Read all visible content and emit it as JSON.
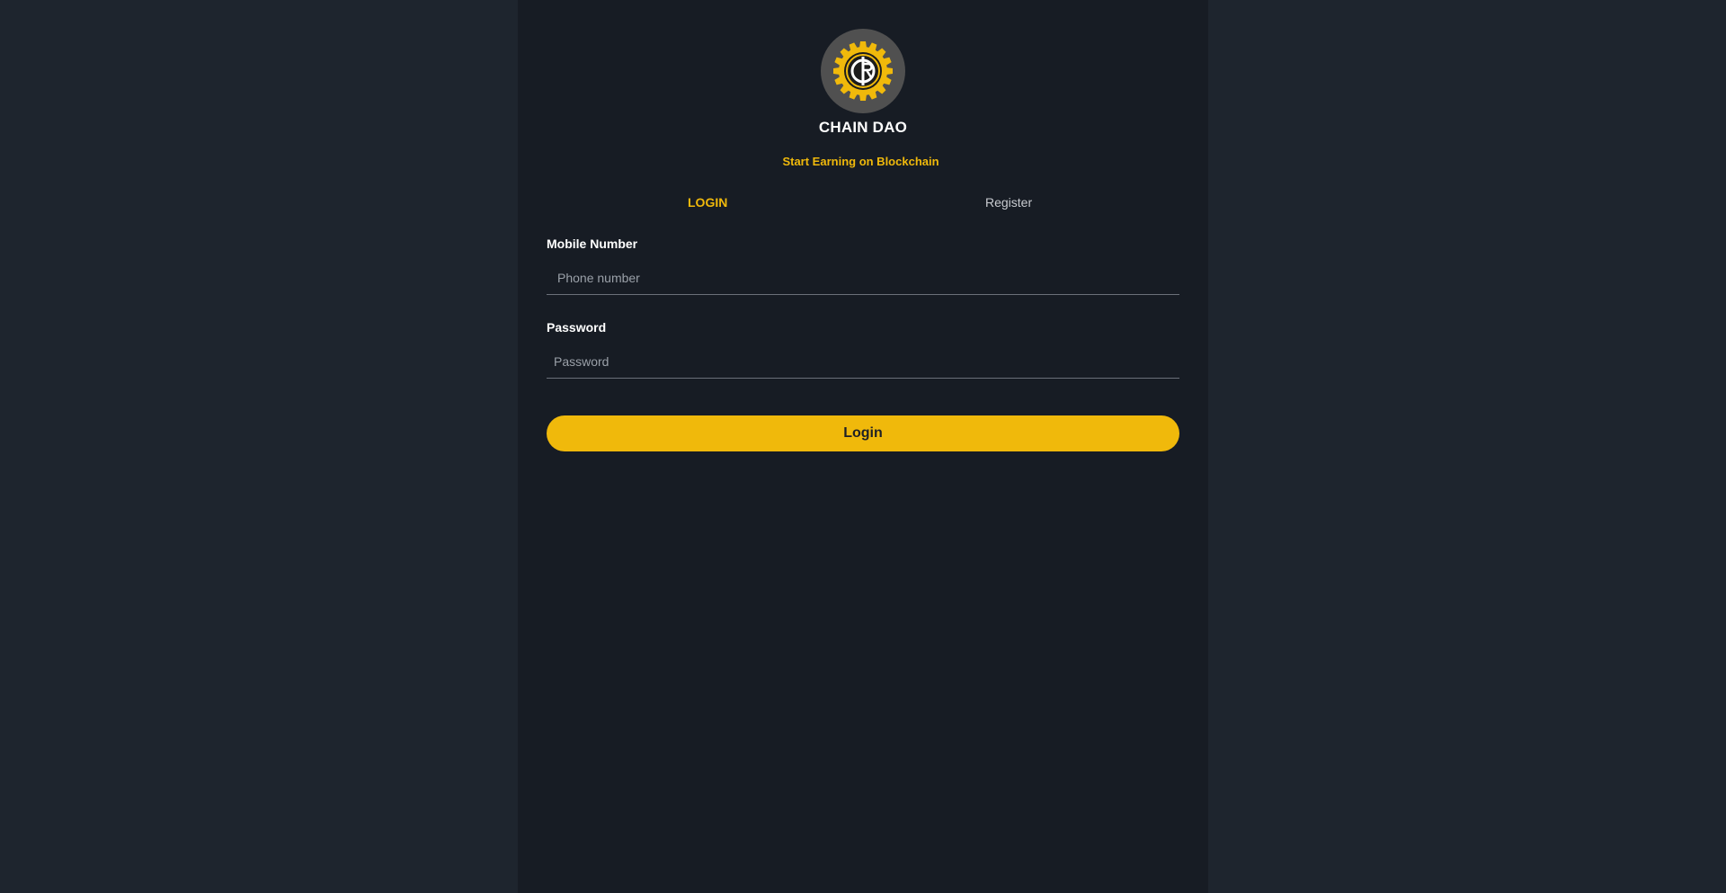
{
  "app": {
    "name": "CHAIN DAO",
    "tagline": "Start Earning on Blockchain",
    "logo_icon": "gear-logo-icon"
  },
  "tabs": {
    "login": "LOGIN",
    "register": "Register"
  },
  "form": {
    "mobile_label": "Mobile Number",
    "mobile_placeholder": "Phone number",
    "password_label": "Password",
    "password_placeholder": "Password",
    "submit_label": "Login"
  },
  "colors": {
    "accent": "#f0b90b",
    "panel": "#171c24",
    "page": "#1e252e"
  }
}
